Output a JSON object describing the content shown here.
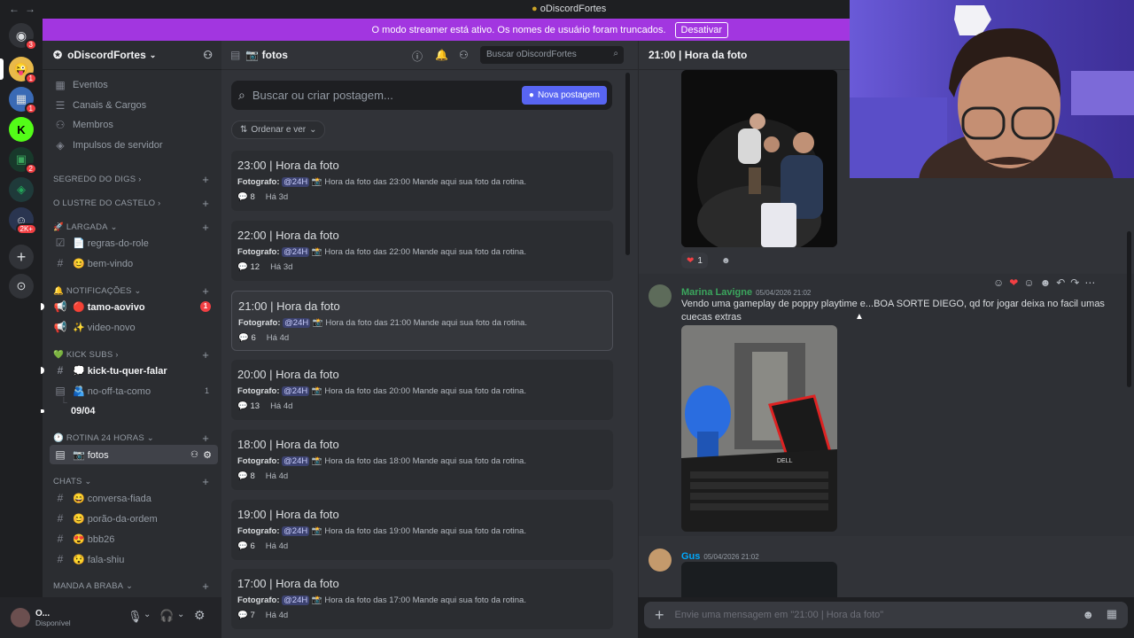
{
  "window": {
    "title": "oDiscordFortes",
    "back": "←",
    "forward": "→"
  },
  "banner": {
    "text": "O modo streamer está ativo. Os nomes de usuário foram truncados.",
    "button": "Desativar"
  },
  "rail": {
    "badges": {
      "home": "3",
      "s1": "1",
      "s2": "1",
      "s3": "2",
      "s4": "2K+"
    }
  },
  "server": {
    "name": "oDiscordFortes"
  },
  "sidebar": {
    "top_items": [
      "Eventos",
      "Canais & Cargos",
      "Membros",
      "Impulsos de servidor"
    ],
    "categories": {
      "segredo": "SEGREDO DO DIGS",
      "lustre": "O LUSTRE DO CASTELO",
      "largada": "🚀 LARGADA",
      "notificacoes": "🔔 NOTIFICAÇÕES",
      "kick": "💚 KICK SUBS",
      "rotina": "🕐 ROTINA 24 HORAS",
      "chats": "CHATS",
      "manda": "MANDA A BRABA"
    },
    "channels": {
      "regras": "📄 regras-do-role",
      "bemvindo": "😊 bem-vindo",
      "tamo": "🔴 tamo-aovivo",
      "tamo_badge": "1",
      "video": "✨ video-novo",
      "kickfalar": "💭 kick-tu-quer-falar",
      "nooff": "🫂 no-off-ta-como",
      "nooff_count": "1",
      "thread0904": "09/04",
      "fotos": "📷 fotos",
      "conversa": "😄 conversa-fiada",
      "porao": "😊 porão-da-ordem",
      "bbb": "😍 bbb26",
      "fala": "😯 fala-shiu"
    }
  },
  "user": {
    "name": "O...",
    "status": "Disponível"
  },
  "forum": {
    "title": "📷 fotos",
    "search_placeholder": "Buscar oDiscordFortes",
    "post_search": "Buscar ou criar postagem...",
    "new_post": "Nova postagem",
    "sort": "Ordenar e ver",
    "posts": [
      {
        "title": "23:00 | Hora da foto",
        "label": "Fotografo",
        "mention": "@24H",
        "desc": "📸 Hora da foto das 23:00 Mande aqui sua foto da rotina.",
        "count": "8",
        "age": "Há 3d"
      },
      {
        "title": "22:00 | Hora da foto",
        "label": "Fotografo",
        "mention": "@24H",
        "desc": "📸 Hora da foto das 22:00 Mande aqui sua foto da rotina.",
        "count": "12",
        "age": "Há 3d"
      },
      {
        "title": "21:00 | Hora da foto",
        "label": "Fotografo",
        "mention": "@24H",
        "desc": "📸 Hora da foto das 21:00 Mande aqui sua foto da rotina.",
        "count": "6",
        "age": "Há 4d"
      },
      {
        "title": "20:00 | Hora da foto",
        "label": "Fotografo",
        "mention": "@24H",
        "desc": "📸 Hora da foto das 20:00 Mande aqui sua foto da rotina.",
        "count": "13",
        "age": "Há 4d"
      },
      {
        "title": "18:00 | Hora da foto",
        "label": "Fotografo",
        "mention": "@24H",
        "desc": "📸 Hora da foto das 18:00 Mande aqui sua foto da rotina.",
        "count": "8",
        "age": "Há 4d"
      },
      {
        "title": "19:00 | Hora da foto",
        "label": "Fotografo",
        "mention": "@24H",
        "desc": "📸 Hora da foto das 19:00 Mande aqui sua foto da rotina.",
        "count": "6",
        "age": "Há 4d"
      },
      {
        "title": "17:00 | Hora da foto",
        "label": "Fotografo",
        "mention": "@24H",
        "desc": "📸 Hora da foto das 17:00 Mande aqui sua foto da rotina.",
        "count": "7",
        "age": "Há 4d"
      }
    ]
  },
  "thread": {
    "title": "21:00 | Hora da foto",
    "reaction_count": "1",
    "msg1": {
      "author": "Marina Lavigne",
      "time": "05/04/2026 21:02",
      "text": "Vendo uma gameplay de poppy playtime e...BOA SORTE DIEGO, qd for jogar deixa no facil umas cuecas extras",
      "laptop_brand": "DELL"
    },
    "msg2": {
      "author": "Gus",
      "time": "05/04/2026 21:02"
    },
    "composer_placeholder": "Envie uma mensagem em \"21:00 | Hora da foto\""
  },
  "colors": {
    "accent": "#5865f2",
    "banner": "#a236e0",
    "marina": "#3ba55d",
    "gus": "#00a8fc"
  }
}
